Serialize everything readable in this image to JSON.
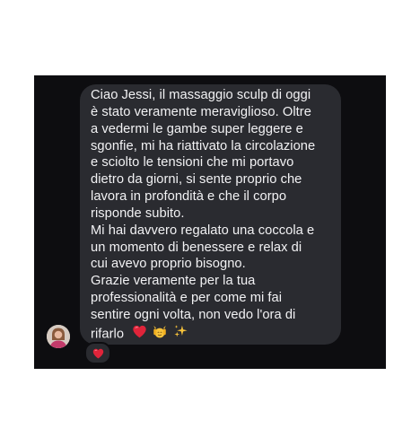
{
  "message": {
    "lines": [
      "Ciao Jessi, il massaggio sculp di oggi",
      "è stato veramente meraviglioso. Oltre",
      "a vedermi le gambe super leggere e",
      "sgonfie, mi ha riattivato la circolazione",
      "e sciolto le tensioni che mi portavo",
      "dietro da giorni, si sente proprio che",
      "lavora in profondità e che il corpo",
      "risponde subito.",
      "Mi hai davvero regalato una coccola e",
      "un momento di benessere e relax di",
      "cui avevo proprio bisogno.",
      "Grazie veramente per la tua",
      "professionalità e per come mi fai",
      "sentire ogni volta, non vedo l'ora di",
      "rifarlo"
    ],
    "trailing_emojis": [
      "red-heart-icon",
      "raising-hands-icon",
      "sparkles-icon"
    ]
  },
  "reaction": {
    "icon": "red-heart-icon"
  },
  "sender": {
    "avatar_icon": "avatar"
  },
  "colors": {
    "panel_background": "#0d0d10",
    "bubble_background": "#2a2b30",
    "text": "#f2f2f4",
    "heart": "#e0243a"
  }
}
